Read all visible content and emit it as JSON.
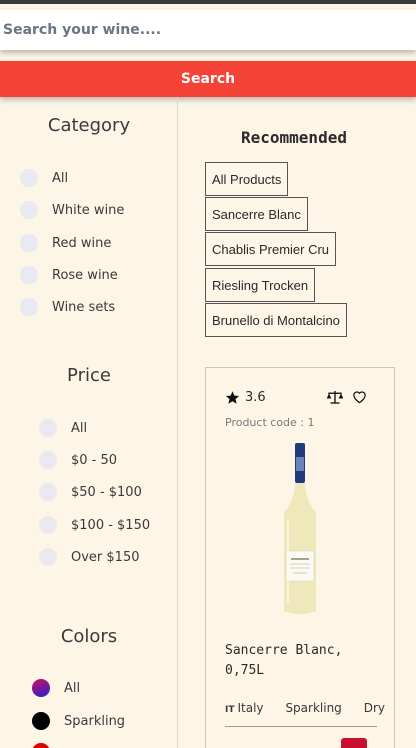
{
  "search": {
    "placeholder": "Search your wine....",
    "button_label": "Search"
  },
  "sidebar": {
    "category": {
      "title": "Category",
      "options": [
        "All",
        "White wine",
        "Red wine",
        "Rose wine",
        "Wine sets"
      ]
    },
    "price": {
      "title": "Price",
      "options": [
        "All",
        "$0 - 50",
        "$50 - $100",
        "$100 - $150",
        "Over $150"
      ]
    },
    "colors": {
      "title": "Colors",
      "options": [
        {
          "label": "All",
          "color": "gradient-purple-blue"
        },
        {
          "label": "Sparkling",
          "color": "#000000"
        },
        {
          "label": "",
          "color": "#e00000"
        }
      ]
    }
  },
  "main": {
    "recommended_title": "Recommended",
    "chips": [
      "All Products",
      "Sancerre Blanc",
      "Chablis Premier Cru",
      "Riesling Trocken",
      "Brunello di Montalcino"
    ]
  },
  "product": {
    "rating": "3.6",
    "code": "Product code : 1",
    "name": "Sancerre Blanc, 0,75L",
    "country_code": "IT",
    "country": "Italy",
    "type": "Sparkling",
    "taste": "Dry",
    "icons": [
      "star-icon",
      "compare-scale-icon",
      "heart-icon",
      "cart-icon"
    ],
    "accent": "#c8102e"
  },
  "colors": {
    "search_button": "#f44336",
    "background": "#fdf5e6"
  }
}
